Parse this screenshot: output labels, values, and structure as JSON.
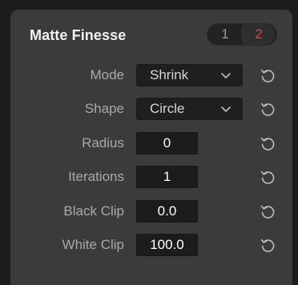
{
  "panel": {
    "title": "Matte Finesse",
    "pages": [
      {
        "label": "1",
        "active": false
      },
      {
        "label": "2",
        "active": true
      }
    ]
  },
  "controls": [
    {
      "label": "Mode",
      "type": "dropdown",
      "value": "Shrink",
      "icon": "chevron-down-icon"
    },
    {
      "label": "Shape",
      "type": "dropdown",
      "value": "Circle",
      "icon": "chevron-down-icon"
    },
    {
      "label": "Radius",
      "type": "field",
      "value": "0"
    },
    {
      "label": "Iterations",
      "type": "field",
      "value": "1"
    },
    {
      "label": "Black Clip",
      "type": "field",
      "value": "0.0"
    },
    {
      "label": "White Clip",
      "type": "field",
      "value": "100.0"
    }
  ],
  "icons": {
    "reset": "reset-icon"
  },
  "colors": {
    "panel_bg": "#3b3b3d",
    "active_page": "#e0463e",
    "field_bg": "#1c1c1e",
    "label_text": "#a9a9ab"
  }
}
